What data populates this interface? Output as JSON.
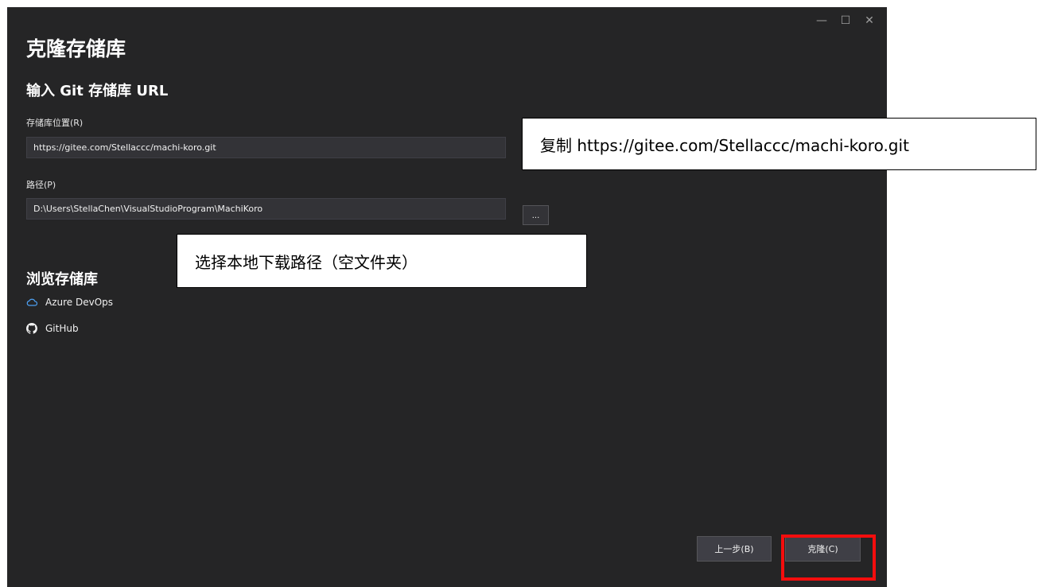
{
  "window": {
    "title": "克隆存储库",
    "controls": {
      "minimize": "—",
      "maximize": "☐",
      "close": "✕"
    }
  },
  "repo_url": {
    "section_title": "输入 Git 存储库 URL",
    "location_label": "存储库位置(R)",
    "location_value": "https://gitee.com/Stellaccc/machi-koro.git",
    "path_label": "路径(P)",
    "path_value": "D:\\Users\\StellaChen\\VisualStudioProgram\\MachiKoro",
    "browse_label": "..."
  },
  "browse": {
    "title": "浏览存储库",
    "providers": [
      {
        "label": "Azure DevOps",
        "icon": "cloud-icon"
      },
      {
        "label": "GitHub",
        "icon": "github-icon"
      }
    ]
  },
  "footer": {
    "back_label": "上一步(B)",
    "clone_label": "克隆(C)"
  },
  "annotations": {
    "url_note": "复制 https://gitee.com/Stellaccc/machi-koro.git",
    "path_note": "选择本地下载路径（空文件夹）",
    "highlight_color": "#f40d0d"
  },
  "colors": {
    "background": "#252526",
    "input_bg": "#333337",
    "button_bg": "#3f3f46"
  }
}
